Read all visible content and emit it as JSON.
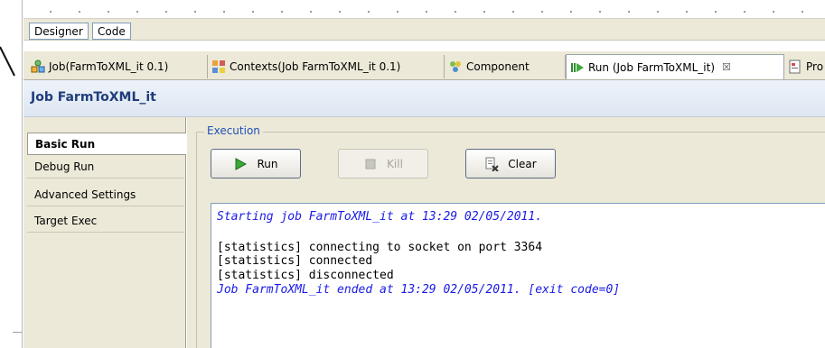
{
  "designer_bar": {
    "designer_label": "Designer",
    "code_label": "Code"
  },
  "editor_tabs": [
    {
      "label": "Job(FarmToXML_it 0.1)",
      "icon": "job-icon"
    },
    {
      "label": "Contexts(Job FarmToXML_it 0.1)",
      "icon": "contexts-icon"
    },
    {
      "label": "Component",
      "icon": "component-icon"
    },
    {
      "label": "Run (Job FarmToXML_it)",
      "icon": "run-icon",
      "active": true,
      "close": "☒"
    },
    {
      "label": "Pro",
      "icon": "properties-icon"
    }
  ],
  "title": "Job FarmToXML_it",
  "nav": {
    "items": [
      "Basic Run",
      "Debug Run",
      "Advanced Settings",
      "Target Exec"
    ],
    "selected": "Basic Run"
  },
  "execution": {
    "legend": "Execution",
    "run_label": "Run",
    "kill_label": "Kill",
    "clear_label": "Clear"
  },
  "console": {
    "lines": [
      "Starting job FarmToXML_it at 13:29 02/05/2011.",
      "[statistics] connecting to socket on port 3364",
      "[statistics] connected",
      "[statistics] disconnected",
      "Job FarmToXML_it ended at 13:29 02/05/2011. [exit code=0]"
    ]
  },
  "colors": {
    "accent_blue": "#1a1ae6",
    "title_blue": "#1f3d7a",
    "panel_bg": "#ece9d8"
  }
}
